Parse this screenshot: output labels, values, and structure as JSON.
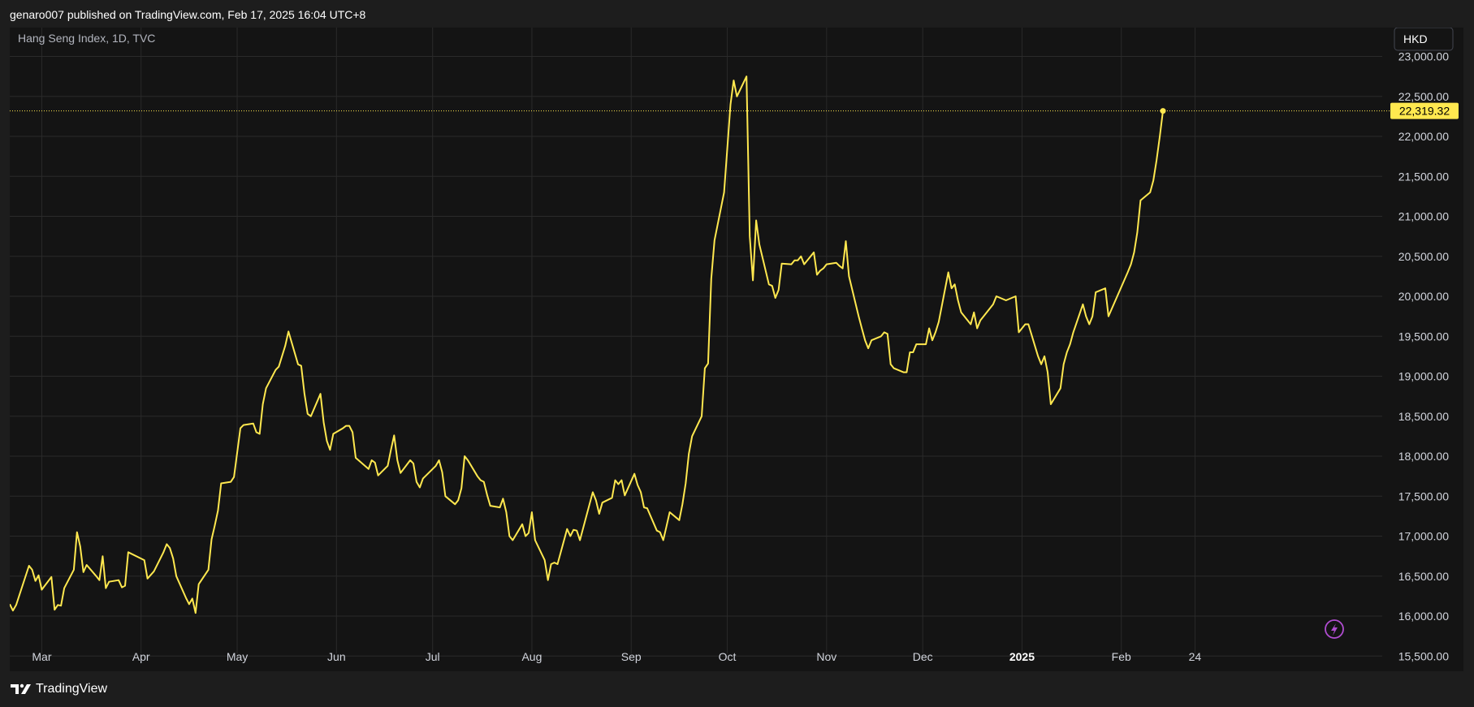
{
  "header": {
    "published_text": "genaro007 published on TradingView.com, Feb 17, 2025 16:04 UTC+8"
  },
  "footer": {
    "brand": "TradingView"
  },
  "colors": {
    "line": "#ffe84f",
    "background": "#141414",
    "grid": "#2a2a2a",
    "page": "#1d1d1d"
  },
  "icons": [
    "tradingview-logo-icon",
    "lightning-icon"
  ],
  "chart_data": {
    "type": "line",
    "symbol_label": "Hang Seng Index, 1D, TVC",
    "currency": "HKD",
    "last_price_label": "22,319.32",
    "last_price": 22319.32,
    "y_range": [
      15300,
      23300
    ],
    "y_ticks": [
      15500,
      16000,
      16500,
      17000,
      17500,
      18000,
      18500,
      19000,
      19500,
      20000,
      20500,
      21000,
      21500,
      22000,
      22500,
      23000
    ],
    "y_tick_labels": [
      "15,500.00",
      "16,000.00",
      "16,500.00",
      "17,000.00",
      "17,500.00",
      "18,000.00",
      "18,500.00",
      "19,000.00",
      "19,500.00",
      "20,000.00",
      "20,500.00",
      "21,000.00",
      "21,500.00",
      "22,000.00",
      "22,500.00",
      "23,000.00"
    ],
    "x_range": [
      "2024-02-20",
      "2025-03-01"
    ],
    "x_ticks": [
      {
        "label": "Mar",
        "date": "2024-03-01"
      },
      {
        "label": "Apr",
        "date": "2024-04-01"
      },
      {
        "label": "May",
        "date": "2024-05-01"
      },
      {
        "label": "Jun",
        "date": "2024-06-01"
      },
      {
        "label": "Jul",
        "date": "2024-07-01"
      },
      {
        "label": "Aug",
        "date": "2024-08-01"
      },
      {
        "label": "Sep",
        "date": "2024-09-01"
      },
      {
        "label": "Oct",
        "date": "2024-10-01"
      },
      {
        "label": "Nov",
        "date": "2024-11-01"
      },
      {
        "label": "Dec",
        "date": "2024-12-01"
      },
      {
        "label": "2025",
        "date": "2025-01-01",
        "bold": true
      },
      {
        "label": "Feb",
        "date": "2025-02-01"
      },
      {
        "label": "24",
        "date": "2025-02-24"
      }
    ],
    "series": [
      {
        "points": [
          [
            "2024-02-20",
            16150
          ],
          [
            "2024-02-21",
            16070
          ],
          [
            "2024-02-22",
            16140
          ],
          [
            "2024-02-26",
            16630
          ],
          [
            "2024-02-27",
            16580
          ],
          [
            "2024-02-28",
            16440
          ],
          [
            "2024-02-29",
            16510
          ],
          [
            "2024-03-01",
            16330
          ],
          [
            "2024-03-04",
            16490
          ],
          [
            "2024-03-05",
            16080
          ],
          [
            "2024-03-06",
            16140
          ],
          [
            "2024-03-07",
            16130
          ],
          [
            "2024-03-08",
            16350
          ],
          [
            "2024-03-11",
            16580
          ],
          [
            "2024-03-12",
            17050
          ],
          [
            "2024-03-13",
            16870
          ],
          [
            "2024-03-14",
            16550
          ],
          [
            "2024-03-15",
            16640
          ],
          [
            "2024-03-18",
            16500
          ],
          [
            "2024-03-19",
            16450
          ],
          [
            "2024-03-20",
            16750
          ],
          [
            "2024-03-21",
            16350
          ],
          [
            "2024-03-22",
            16430
          ],
          [
            "2024-03-25",
            16450
          ],
          [
            "2024-03-26",
            16360
          ],
          [
            "2024-03-27",
            16380
          ],
          [
            "2024-03-28",
            16800
          ],
          [
            "2024-04-02",
            16700
          ],
          [
            "2024-04-03",
            16470
          ],
          [
            "2024-04-05",
            16560
          ],
          [
            "2024-04-08",
            16800
          ],
          [
            "2024-04-09",
            16900
          ],
          [
            "2024-04-10",
            16850
          ],
          [
            "2024-04-11",
            16720
          ],
          [
            "2024-04-12",
            16500
          ],
          [
            "2024-04-15",
            16230
          ],
          [
            "2024-04-16",
            16150
          ],
          [
            "2024-04-17",
            16220
          ],
          [
            "2024-04-18",
            16040
          ],
          [
            "2024-04-19",
            16400
          ],
          [
            "2024-04-22",
            16580
          ],
          [
            "2024-04-23",
            16960
          ],
          [
            "2024-04-24",
            17130
          ],
          [
            "2024-04-25",
            17320
          ],
          [
            "2024-04-26",
            17660
          ],
          [
            "2024-04-29",
            17680
          ],
          [
            "2024-04-30",
            17740
          ],
          [
            "2024-05-02",
            18350
          ],
          [
            "2024-05-03",
            18390
          ],
          [
            "2024-05-06",
            18410
          ],
          [
            "2024-05-07",
            18300
          ],
          [
            "2024-05-08",
            18280
          ],
          [
            "2024-05-09",
            18650
          ],
          [
            "2024-05-10",
            18850
          ],
          [
            "2024-05-13",
            19080
          ],
          [
            "2024-05-14",
            19120
          ],
          [
            "2024-05-16",
            19380
          ],
          [
            "2024-05-17",
            19560
          ],
          [
            "2024-05-20",
            19150
          ],
          [
            "2024-05-21",
            19130
          ],
          [
            "2024-05-22",
            18780
          ],
          [
            "2024-05-23",
            18530
          ],
          [
            "2024-05-24",
            18500
          ],
          [
            "2024-05-27",
            18780
          ],
          [
            "2024-05-28",
            18420
          ],
          [
            "2024-05-29",
            18190
          ],
          [
            "2024-05-30",
            18080
          ],
          [
            "2024-05-31",
            18280
          ],
          [
            "2024-06-03",
            18350
          ],
          [
            "2024-06-04",
            18380
          ],
          [
            "2024-06-05",
            18380
          ],
          [
            "2024-06-06",
            18300
          ],
          [
            "2024-06-07",
            17980
          ],
          [
            "2024-06-11",
            17840
          ],
          [
            "2024-06-12",
            17950
          ],
          [
            "2024-06-13",
            17920
          ],
          [
            "2024-06-14",
            17760
          ],
          [
            "2024-06-17",
            17880
          ],
          [
            "2024-06-18",
            18080
          ],
          [
            "2024-06-19",
            18260
          ],
          [
            "2024-06-20",
            17950
          ],
          [
            "2024-06-21",
            17790
          ],
          [
            "2024-06-24",
            17950
          ],
          [
            "2024-06-25",
            17910
          ],
          [
            "2024-06-26",
            17680
          ],
          [
            "2024-06-27",
            17610
          ],
          [
            "2024-06-28",
            17720
          ],
          [
            "2024-07-02",
            17880
          ],
          [
            "2024-07-03",
            17950
          ],
          [
            "2024-07-04",
            17800
          ],
          [
            "2024-07-05",
            17500
          ],
          [
            "2024-07-08",
            17400
          ],
          [
            "2024-07-09",
            17450
          ],
          [
            "2024-07-10",
            17600
          ],
          [
            "2024-07-11",
            18000
          ],
          [
            "2024-07-12",
            17950
          ],
          [
            "2024-07-15",
            17750
          ],
          [
            "2024-07-16",
            17700
          ],
          [
            "2024-07-17",
            17680
          ],
          [
            "2024-07-18",
            17520
          ],
          [
            "2024-07-19",
            17380
          ],
          [
            "2024-07-22",
            17360
          ],
          [
            "2024-07-23",
            17470
          ],
          [
            "2024-07-24",
            17300
          ],
          [
            "2024-07-25",
            17000
          ],
          [
            "2024-07-26",
            16950
          ],
          [
            "2024-07-29",
            17150
          ],
          [
            "2024-07-30",
            17000
          ],
          [
            "2024-07-31",
            17040
          ],
          [
            "2024-08-01",
            17300
          ],
          [
            "2024-08-02",
            16950
          ],
          [
            "2024-08-05",
            16700
          ],
          [
            "2024-08-06",
            16450
          ],
          [
            "2024-08-07",
            16650
          ],
          [
            "2024-08-08",
            16670
          ],
          [
            "2024-08-09",
            16650
          ],
          [
            "2024-08-12",
            17090
          ],
          [
            "2024-08-13",
            17000
          ],
          [
            "2024-08-14",
            17080
          ],
          [
            "2024-08-15",
            17070
          ],
          [
            "2024-08-16",
            16950
          ],
          [
            "2024-08-19",
            17400
          ],
          [
            "2024-08-20",
            17550
          ],
          [
            "2024-08-21",
            17450
          ],
          [
            "2024-08-22",
            17280
          ],
          [
            "2024-08-23",
            17420
          ],
          [
            "2024-08-26",
            17480
          ],
          [
            "2024-08-27",
            17700
          ],
          [
            "2024-08-28",
            17650
          ],
          [
            "2024-08-29",
            17700
          ],
          [
            "2024-08-30",
            17510
          ],
          [
            "2024-09-02",
            17780
          ],
          [
            "2024-09-03",
            17640
          ],
          [
            "2024-09-04",
            17550
          ],
          [
            "2024-09-05",
            17360
          ],
          [
            "2024-09-06",
            17350
          ],
          [
            "2024-09-09",
            17070
          ],
          [
            "2024-09-10",
            17050
          ],
          [
            "2024-09-11",
            16950
          ],
          [
            "2024-09-12",
            17120
          ],
          [
            "2024-09-13",
            17300
          ],
          [
            "2024-09-16",
            17200
          ],
          [
            "2024-09-17",
            17400
          ],
          [
            "2024-09-18",
            17660
          ],
          [
            "2024-09-19",
            18030
          ],
          [
            "2024-09-20",
            18250
          ],
          [
            "2024-09-23",
            18500
          ],
          [
            "2024-09-24",
            19100
          ],
          [
            "2024-09-25",
            19160
          ],
          [
            "2024-09-26",
            20220
          ],
          [
            "2024-09-27",
            20700
          ],
          [
            "2024-09-30",
            21300
          ],
          [
            "2024-10-02",
            22400
          ],
          [
            "2024-10-03",
            22700
          ],
          [
            "2024-10-04",
            22500
          ],
          [
            "2024-10-07",
            22750
          ],
          [
            "2024-10-08",
            20750
          ],
          [
            "2024-10-09",
            20200
          ],
          [
            "2024-10-10",
            20950
          ],
          [
            "2024-10-11",
            20650
          ],
          [
            "2024-10-14",
            20150
          ],
          [
            "2024-10-15",
            20130
          ],
          [
            "2024-10-16",
            19980
          ],
          [
            "2024-10-17",
            20080
          ],
          [
            "2024-10-18",
            20410
          ],
          [
            "2024-10-21",
            20400
          ],
          [
            "2024-10-22",
            20450
          ],
          [
            "2024-10-23",
            20450
          ],
          [
            "2024-10-24",
            20500
          ],
          [
            "2024-10-25",
            20400
          ],
          [
            "2024-10-28",
            20550
          ],
          [
            "2024-10-29",
            20270
          ],
          [
            "2024-10-30",
            20320
          ],
          [
            "2024-10-31",
            20350
          ],
          [
            "2024-11-01",
            20400
          ],
          [
            "2024-11-04",
            20420
          ],
          [
            "2024-11-05",
            20380
          ],
          [
            "2024-11-06",
            20350
          ],
          [
            "2024-11-07",
            20690
          ],
          [
            "2024-11-08",
            20250
          ],
          [
            "2024-11-11",
            19750
          ],
          [
            "2024-11-12",
            19600
          ],
          [
            "2024-11-13",
            19450
          ],
          [
            "2024-11-14",
            19350
          ],
          [
            "2024-11-15",
            19450
          ],
          [
            "2024-11-18",
            19500
          ],
          [
            "2024-11-19",
            19550
          ],
          [
            "2024-11-20",
            19530
          ],
          [
            "2024-11-21",
            19150
          ],
          [
            "2024-11-22",
            19100
          ],
          [
            "2024-11-25",
            19050
          ],
          [
            "2024-11-26",
            19050
          ],
          [
            "2024-11-27",
            19300
          ],
          [
            "2024-11-28",
            19300
          ],
          [
            "2024-11-29",
            19400
          ],
          [
            "2024-12-02",
            19400
          ],
          [
            "2024-12-03",
            19600
          ],
          [
            "2024-12-04",
            19450
          ],
          [
            "2024-12-05",
            19550
          ],
          [
            "2024-12-06",
            19680
          ],
          [
            "2024-12-09",
            20300
          ],
          [
            "2024-12-10",
            20100
          ],
          [
            "2024-12-11",
            20150
          ],
          [
            "2024-12-12",
            19950
          ],
          [
            "2024-12-13",
            19800
          ],
          [
            "2024-12-16",
            19650
          ],
          [
            "2024-12-17",
            19800
          ],
          [
            "2024-12-18",
            19600
          ],
          [
            "2024-12-19",
            19700
          ],
          [
            "2024-12-20",
            19750
          ],
          [
            "2024-12-23",
            19900
          ],
          [
            "2024-12-24",
            20000
          ],
          [
            "2024-12-27",
            19950
          ],
          [
            "2024-12-30",
            20000
          ],
          [
            "2024-12-31",
            19550
          ],
          [
            "2025-01-02",
            19650
          ],
          [
            "2025-01-03",
            19650
          ],
          [
            "2025-01-06",
            19250
          ],
          [
            "2025-01-07",
            19150
          ],
          [
            "2025-01-08",
            19250
          ],
          [
            "2025-01-09",
            19050
          ],
          [
            "2025-01-10",
            18650
          ],
          [
            "2025-01-13",
            18850
          ],
          [
            "2025-01-14",
            19150
          ],
          [
            "2025-01-15",
            19300
          ],
          [
            "2025-01-16",
            19400
          ],
          [
            "2025-01-17",
            19550
          ],
          [
            "2025-01-20",
            19900
          ],
          [
            "2025-01-21",
            19750
          ],
          [
            "2025-01-22",
            19650
          ],
          [
            "2025-01-23",
            19750
          ],
          [
            "2025-01-24",
            20050
          ],
          [
            "2025-01-27",
            20100
          ],
          [
            "2025-01-28",
            19750
          ],
          [
            "2025-02-03",
            20300
          ],
          [
            "2025-02-04",
            20400
          ],
          [
            "2025-02-05",
            20550
          ],
          [
            "2025-02-06",
            20800
          ],
          [
            "2025-02-07",
            21200
          ],
          [
            "2025-02-10",
            21300
          ],
          [
            "2025-02-11",
            21450
          ],
          [
            "2025-02-12",
            21700
          ],
          [
            "2025-02-13",
            22000
          ],
          [
            "2025-02-14",
            22319.32
          ]
        ]
      }
    ]
  }
}
